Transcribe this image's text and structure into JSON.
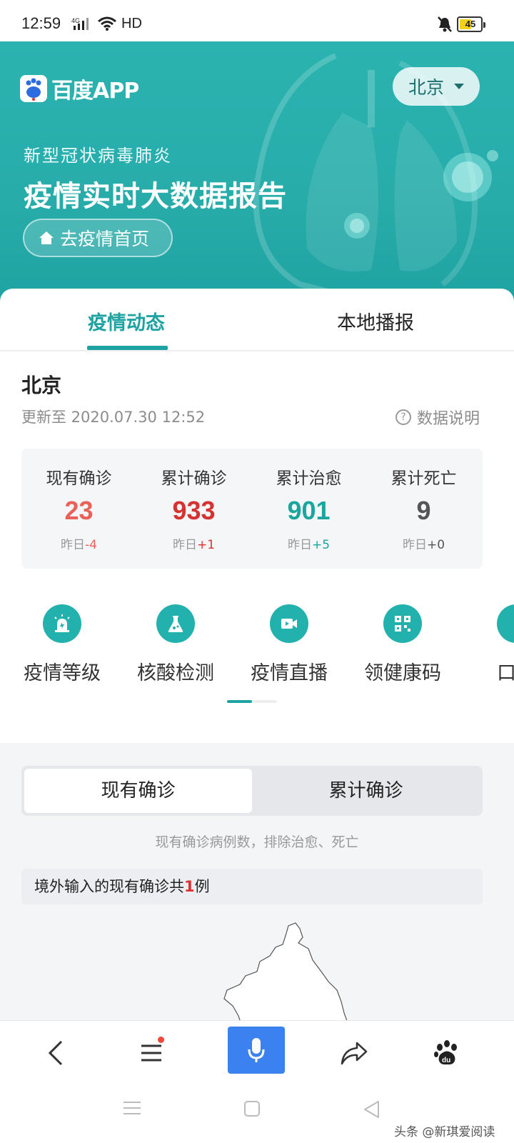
{
  "status_bar": {
    "time": "12:59",
    "network": "4G",
    "hd": "HD",
    "battery": "45",
    "icons": [
      "signal-icon",
      "wifi-icon",
      "mute-icon",
      "battery-icon"
    ]
  },
  "header": {
    "logo_text": "百度APP",
    "city": "北京",
    "subtitle": "新型冠状病毒肺炎",
    "title": "疫情实时大数据报告",
    "home_button": "去疫情首页"
  },
  "tabs": [
    {
      "label": "疫情动态",
      "active": true
    },
    {
      "label": "本地播报",
      "active": false
    }
  ],
  "region": {
    "name": "北京",
    "updated": "更新至 2020.07.30 12:52",
    "data_note": "数据说明"
  },
  "stats": [
    {
      "label": "现有确诊",
      "value": "23",
      "delta_prefix": "昨日",
      "delta": "-4",
      "color": "#e8625a",
      "delta_color": "#e8625a"
    },
    {
      "label": "累计确诊",
      "value": "933",
      "delta_prefix": "昨日",
      "delta": "+1",
      "color": "#d63232",
      "delta_color": "#d63232"
    },
    {
      "label": "累计治愈",
      "value": "901",
      "delta_prefix": "昨日",
      "delta": "+5",
      "color": "#1aa59f",
      "delta_color": "#1aa59f"
    },
    {
      "label": "累计死亡",
      "value": "9",
      "delta_prefix": "昨日",
      "delta": "+0",
      "color": "#555555",
      "delta_color": "#555555"
    }
  ],
  "quick_links": [
    {
      "label": "疫情等级",
      "icon": "alarm-icon"
    },
    {
      "label": "核酸检测",
      "icon": "flask-icon"
    },
    {
      "label": "疫情直播",
      "icon": "video-icon"
    },
    {
      "label": "领健康码",
      "icon": "qrcode-icon"
    },
    {
      "label": "口罩",
      "icon": "mask-icon"
    }
  ],
  "scroll_progress": 0.5,
  "segment": {
    "options": [
      "现有确诊",
      "累计确诊"
    ],
    "selected": "现有确诊",
    "note": "现有确诊病例数，排除治愈、死亡"
  },
  "imported": {
    "prefix": "境外输入的现有确诊共",
    "count": "1",
    "suffix": "例"
  },
  "toolbar": {
    "items": [
      "back-icon",
      "menu-icon",
      "microphone-icon",
      "share-icon",
      "baidu-paw-icon"
    ]
  },
  "system_nav": [
    "recents-icon",
    "home-icon",
    "back-triangle-icon"
  ],
  "watermark": "头条 @新琪爱阅读",
  "colors": {
    "accent": "#1fa3a2",
    "banner": "#27acaa",
    "mic": "#3b82f0"
  }
}
